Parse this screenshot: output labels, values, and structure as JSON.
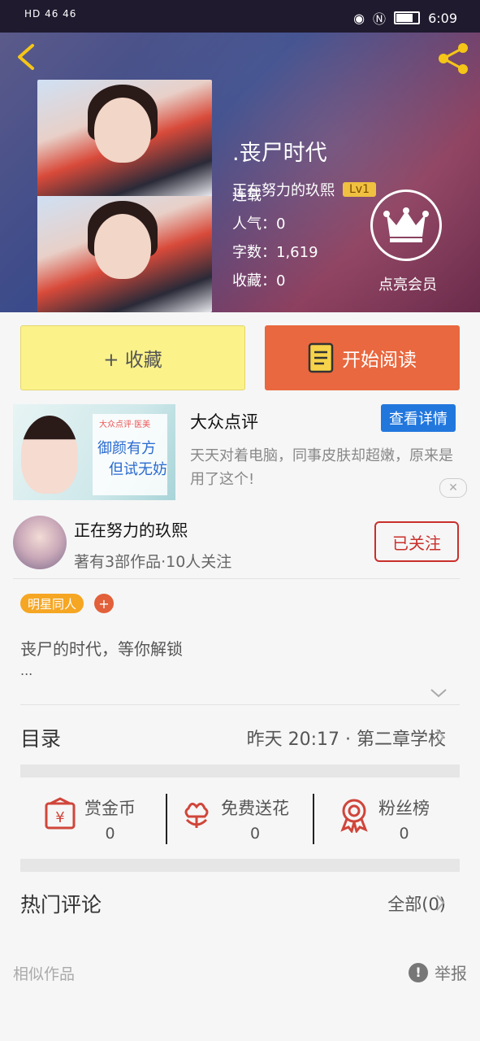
{
  "status_bar": {
    "left": "HD 46 46",
    "time": "6:09"
  },
  "book": {
    "title": ".丧尸时代",
    "author": "正在努力的玖熙",
    "level": "Lv1",
    "status": "连载",
    "popularity": "人气：0",
    "word_count": "字数：1,619",
    "favorites": "收藏：0",
    "vip_label": "点亮会员"
  },
  "actions": {
    "favorite_label": "+ 收藏",
    "read_label": "开始阅读"
  },
  "ad": {
    "title": "大众点评",
    "button": "查看详情",
    "desc": "天天对着电脑，同事皮肤却超嫩，原来是用了这个!",
    "image_logo": "大众点评·医美",
    "image_line1": "御颜有方",
    "image_line2": "但试无妨",
    "close": "✕"
  },
  "author_card": {
    "name": "正在努力的玖熙",
    "sub": "著有3部作品·10人关注",
    "follow_label": "已关注"
  },
  "tags": [
    "明星同人"
  ],
  "tag_add": "+",
  "intro": {
    "text": "丧尸的时代，等你解锁",
    "more": "..."
  },
  "toc": {
    "label": "目录",
    "latest": "昨天 20:17 · 第二章学校"
  },
  "stats": [
    {
      "label": "赏金币",
      "value": "0",
      "icon": "reward-coin-icon"
    },
    {
      "label": "免费送花",
      "value": "0",
      "icon": "flower-icon"
    },
    {
      "label": "粉丝榜",
      "value": "0",
      "icon": "medal-icon"
    }
  ],
  "hot_comments": {
    "label": "热门评论",
    "all": "全部(0)"
  },
  "footer": {
    "similar": "相似作品",
    "report": "举报"
  },
  "colors": {
    "accent": "#e9683f",
    "fav_bg": "#fbf28a",
    "follow": "#c9302c",
    "tag": "#f5a623",
    "ad_button": "#2277dd"
  }
}
